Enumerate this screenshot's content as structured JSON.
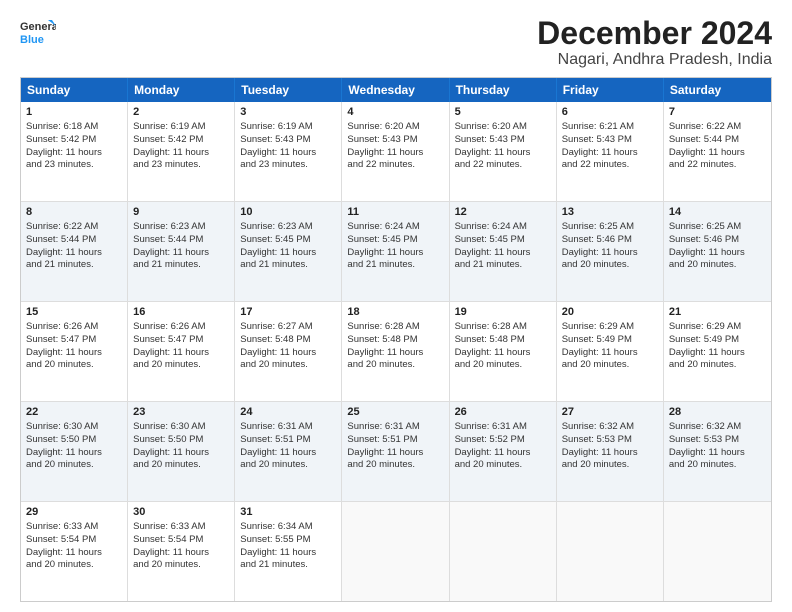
{
  "logo": {
    "line1": "General",
    "line2": "Blue"
  },
  "title": "December 2024",
  "subtitle": "Nagari, Andhra Pradesh, India",
  "header_days": [
    "Sunday",
    "Monday",
    "Tuesday",
    "Wednesday",
    "Thursday",
    "Friday",
    "Saturday"
  ],
  "weeks": [
    [
      {
        "day": "1",
        "info": "Sunrise: 6:18 AM\nSunset: 5:42 PM\nDaylight: 11 hours\nand 23 minutes."
      },
      {
        "day": "2",
        "info": "Sunrise: 6:19 AM\nSunset: 5:42 PM\nDaylight: 11 hours\nand 23 minutes."
      },
      {
        "day": "3",
        "info": "Sunrise: 6:19 AM\nSunset: 5:43 PM\nDaylight: 11 hours\nand 23 minutes."
      },
      {
        "day": "4",
        "info": "Sunrise: 6:20 AM\nSunset: 5:43 PM\nDaylight: 11 hours\nand 22 minutes."
      },
      {
        "day": "5",
        "info": "Sunrise: 6:20 AM\nSunset: 5:43 PM\nDaylight: 11 hours\nand 22 minutes."
      },
      {
        "day": "6",
        "info": "Sunrise: 6:21 AM\nSunset: 5:43 PM\nDaylight: 11 hours\nand 22 minutes."
      },
      {
        "day": "7",
        "info": "Sunrise: 6:22 AM\nSunset: 5:44 PM\nDaylight: 11 hours\nand 22 minutes."
      }
    ],
    [
      {
        "day": "8",
        "info": "Sunrise: 6:22 AM\nSunset: 5:44 PM\nDaylight: 11 hours\nand 21 minutes."
      },
      {
        "day": "9",
        "info": "Sunrise: 6:23 AM\nSunset: 5:44 PM\nDaylight: 11 hours\nand 21 minutes."
      },
      {
        "day": "10",
        "info": "Sunrise: 6:23 AM\nSunset: 5:45 PM\nDaylight: 11 hours\nand 21 minutes."
      },
      {
        "day": "11",
        "info": "Sunrise: 6:24 AM\nSunset: 5:45 PM\nDaylight: 11 hours\nand 21 minutes."
      },
      {
        "day": "12",
        "info": "Sunrise: 6:24 AM\nSunset: 5:45 PM\nDaylight: 11 hours\nand 21 minutes."
      },
      {
        "day": "13",
        "info": "Sunrise: 6:25 AM\nSunset: 5:46 PM\nDaylight: 11 hours\nand 20 minutes."
      },
      {
        "day": "14",
        "info": "Sunrise: 6:25 AM\nSunset: 5:46 PM\nDaylight: 11 hours\nand 20 minutes."
      }
    ],
    [
      {
        "day": "15",
        "info": "Sunrise: 6:26 AM\nSunset: 5:47 PM\nDaylight: 11 hours\nand 20 minutes."
      },
      {
        "day": "16",
        "info": "Sunrise: 6:26 AM\nSunset: 5:47 PM\nDaylight: 11 hours\nand 20 minutes."
      },
      {
        "day": "17",
        "info": "Sunrise: 6:27 AM\nSunset: 5:48 PM\nDaylight: 11 hours\nand 20 minutes."
      },
      {
        "day": "18",
        "info": "Sunrise: 6:28 AM\nSunset: 5:48 PM\nDaylight: 11 hours\nand 20 minutes."
      },
      {
        "day": "19",
        "info": "Sunrise: 6:28 AM\nSunset: 5:48 PM\nDaylight: 11 hours\nand 20 minutes."
      },
      {
        "day": "20",
        "info": "Sunrise: 6:29 AM\nSunset: 5:49 PM\nDaylight: 11 hours\nand 20 minutes."
      },
      {
        "day": "21",
        "info": "Sunrise: 6:29 AM\nSunset: 5:49 PM\nDaylight: 11 hours\nand 20 minutes."
      }
    ],
    [
      {
        "day": "22",
        "info": "Sunrise: 6:30 AM\nSunset: 5:50 PM\nDaylight: 11 hours\nand 20 minutes."
      },
      {
        "day": "23",
        "info": "Sunrise: 6:30 AM\nSunset: 5:50 PM\nDaylight: 11 hours\nand 20 minutes."
      },
      {
        "day": "24",
        "info": "Sunrise: 6:31 AM\nSunset: 5:51 PM\nDaylight: 11 hours\nand 20 minutes."
      },
      {
        "day": "25",
        "info": "Sunrise: 6:31 AM\nSunset: 5:51 PM\nDaylight: 11 hours\nand 20 minutes."
      },
      {
        "day": "26",
        "info": "Sunrise: 6:31 AM\nSunset: 5:52 PM\nDaylight: 11 hours\nand 20 minutes."
      },
      {
        "day": "27",
        "info": "Sunrise: 6:32 AM\nSunset: 5:53 PM\nDaylight: 11 hours\nand 20 minutes."
      },
      {
        "day": "28",
        "info": "Sunrise: 6:32 AM\nSunset: 5:53 PM\nDaylight: 11 hours\nand 20 minutes."
      }
    ],
    [
      {
        "day": "29",
        "info": "Sunrise: 6:33 AM\nSunset: 5:54 PM\nDaylight: 11 hours\nand 20 minutes."
      },
      {
        "day": "30",
        "info": "Sunrise: 6:33 AM\nSunset: 5:54 PM\nDaylight: 11 hours\nand 20 minutes."
      },
      {
        "day": "31",
        "info": "Sunrise: 6:34 AM\nSunset: 5:55 PM\nDaylight: 11 hours\nand 21 minutes."
      },
      {
        "day": "",
        "info": ""
      },
      {
        "day": "",
        "info": ""
      },
      {
        "day": "",
        "info": ""
      },
      {
        "day": "",
        "info": ""
      }
    ]
  ],
  "alt_rows": [
    1,
    3
  ]
}
